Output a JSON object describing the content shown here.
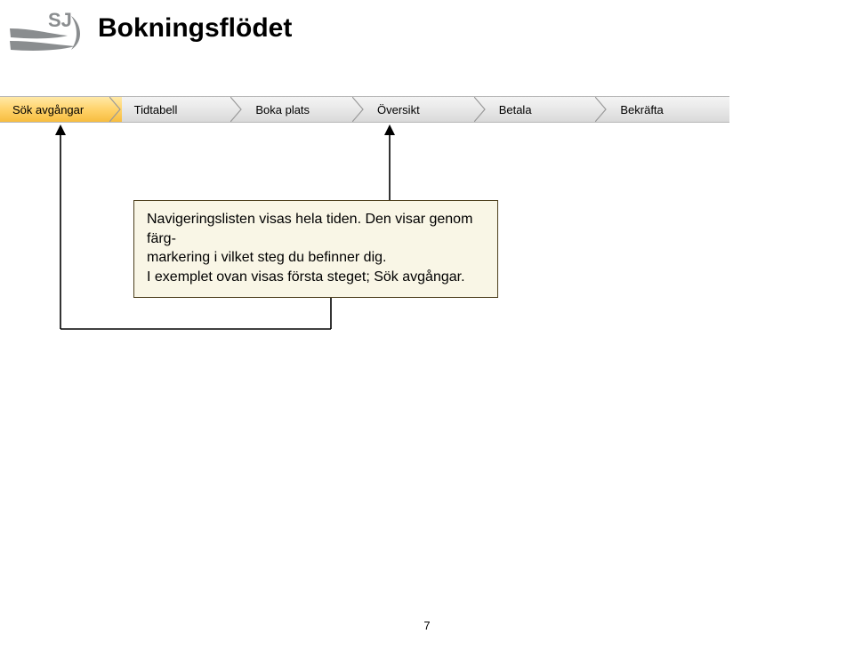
{
  "logo_label": "SJ",
  "page_title": "Bokningsflödet",
  "nav_steps": [
    {
      "label": "Sök avgångar",
      "active": true
    },
    {
      "label": "Tidtabell",
      "active": false
    },
    {
      "label": "Boka plats",
      "active": false
    },
    {
      "label": "Översikt",
      "active": false
    },
    {
      "label": "Betala",
      "active": false
    },
    {
      "label": "Bekräfta",
      "active": false
    }
  ],
  "callout": {
    "line1": "Navigeringslisten visas hela tiden. Den visar genom färg-",
    "line2": "markering i vilket steg du befinner dig.",
    "line3": "I exemplet ovan visas första steget; Sök avgångar."
  },
  "page_number": "7"
}
